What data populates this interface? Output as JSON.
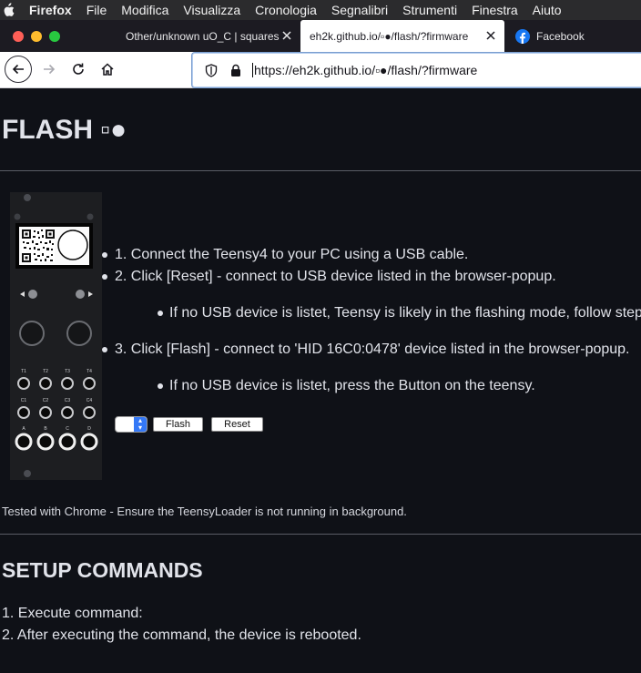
{
  "menubar": {
    "app": "Firefox",
    "items": [
      "File",
      "Modifica",
      "Visualizza",
      "Cronologia",
      "Segnalibri",
      "Strumenti",
      "Finestra",
      "Aiuto"
    ]
  },
  "tabs": [
    {
      "title": "Other/unknown uO_C | squares",
      "active": false
    },
    {
      "title": "eh2k.github.io/▫●/flash/?firmware",
      "active": true
    },
    {
      "title": "Facebook",
      "active": false
    }
  ],
  "urlbar": {
    "url": "https://eh2k.github.io/▫●/flash/?firmware"
  },
  "page": {
    "title": "FLASH ▫●",
    "instructions": [
      "1. Connect the Teensy4 to your PC using a USB cable.",
      "2. Click [Reset] - connect to USB device listed in the browser-popup.",
      "If no USB device is listet, Teensy is likely in the flashing mode, follow step",
      "3. Click [Flash] - connect to 'HID 16C0:0478' device listed in the browser-popup.",
      "If no USB device is listet, press the Button on the teensy."
    ],
    "flash_button": "Flash",
    "reset_button": "Reset",
    "note": "Tested with Chrome - Ensure the TeensyLoader is not running in background.",
    "setup_title": "SETUP COMMANDS",
    "setup_steps": [
      "1. Execute command:",
      "2. After executing the command, the device is rebooted."
    ]
  },
  "module": {
    "jack_labels_row1": [
      "T1",
      "T2",
      "T3",
      "T4"
    ],
    "jack_labels_row2": [
      "C1",
      "C2",
      "C3",
      "C4"
    ],
    "jack_labels_row3": [
      "A",
      "B",
      "C",
      "D"
    ]
  },
  "colors": {
    "page_bg": "#0f1117",
    "text": "#e1e3ea",
    "tabbar_bg": "#1c1b22",
    "accent": "#3478f6"
  }
}
